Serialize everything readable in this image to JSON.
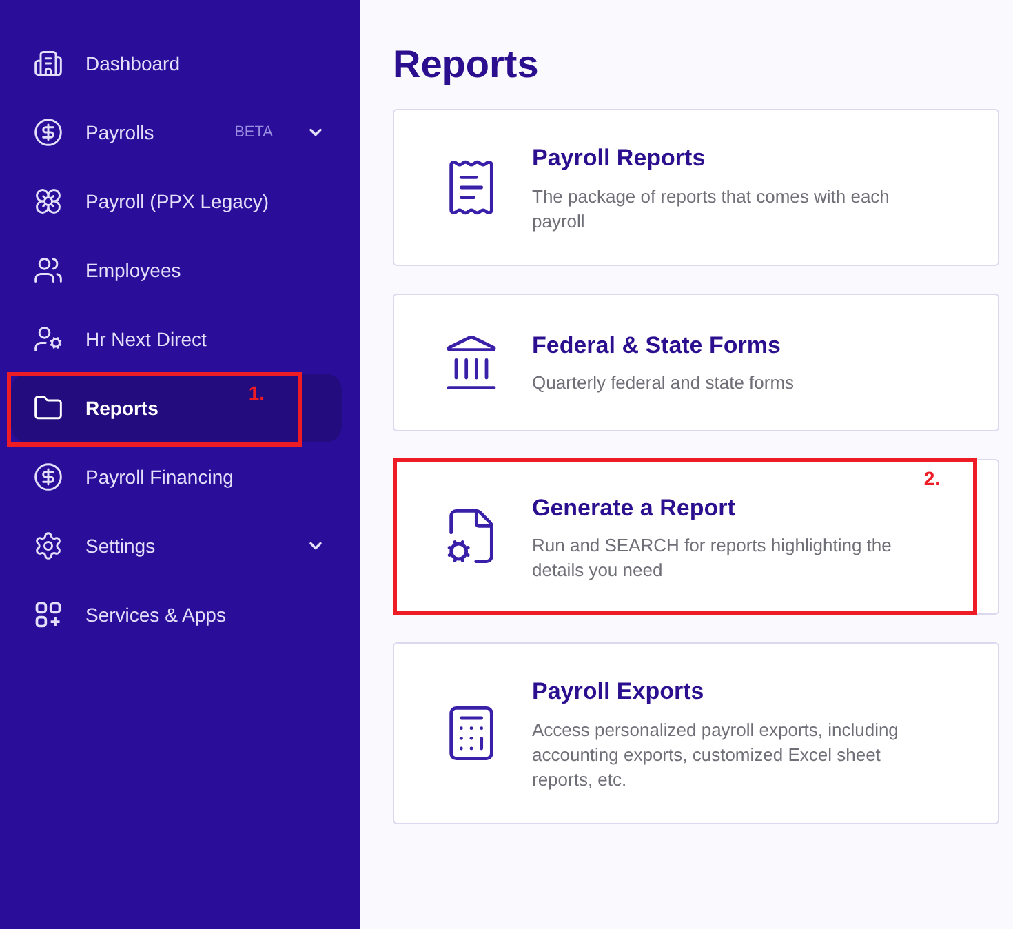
{
  "sidebar": {
    "items": [
      {
        "label": "Dashboard",
        "selected": false,
        "has_submenu": false
      },
      {
        "label": "Payrolls",
        "selected": false,
        "badge": "BETA",
        "has_submenu": true
      },
      {
        "label": "Payroll (PPX Legacy)",
        "selected": false,
        "has_submenu": false
      },
      {
        "label": "Employees",
        "selected": false,
        "has_submenu": false
      },
      {
        "label": "Hr Next Direct",
        "selected": false,
        "has_submenu": false
      },
      {
        "label": "Reports",
        "selected": true,
        "has_submenu": false,
        "annotation": "1."
      },
      {
        "label": "Payroll Financing",
        "selected": false,
        "has_submenu": false
      },
      {
        "label": "Settings",
        "selected": false,
        "has_submenu": true
      },
      {
        "label": "Services & Apps",
        "selected": false,
        "has_submenu": false
      }
    ]
  },
  "page": {
    "title": "Reports",
    "cards": [
      {
        "title": "Payroll Reports",
        "description": "The package of reports that comes with each payroll"
      },
      {
        "title": "Federal & State Forms",
        "description": "Quarterly federal and state forms"
      },
      {
        "title": "Generate a Report",
        "description": "Run and SEARCH for reports highlighting the details you need",
        "annotation": "2."
      },
      {
        "title": "Payroll Exports",
        "description": "Access personalized payroll exports, including accounting exports, customized Excel sheet reports, etc."
      }
    ]
  }
}
